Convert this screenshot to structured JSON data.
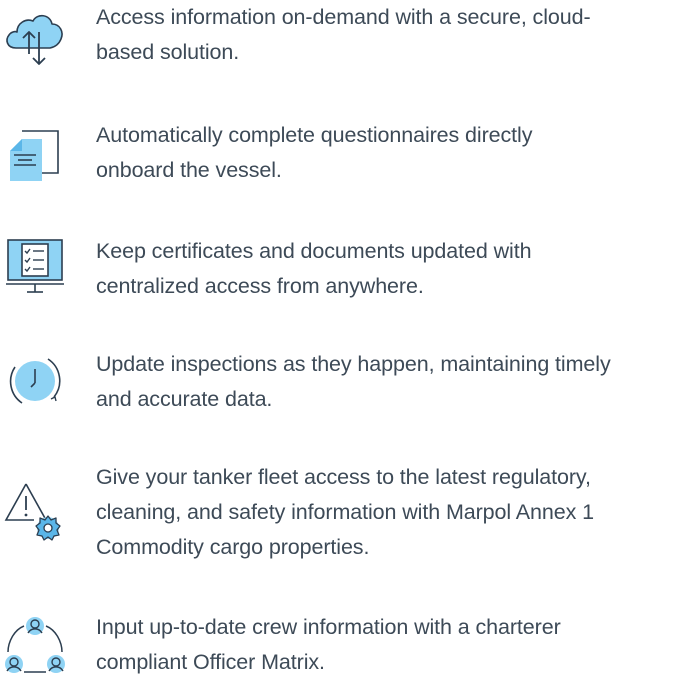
{
  "features": [
    {
      "icon": "cloud-sync-icon",
      "lines": [
        "Access information on-demand with a secure, cloud-",
        "based solution."
      ]
    },
    {
      "icon": "document-questionnaire-icon",
      "lines": [
        "Automatically complete questionnaires directly",
        "onboard the vessel."
      ]
    },
    {
      "icon": "monitor-checklist-icon",
      "lines": [
        "Keep certificates and documents updated with",
        "centralized access from anywhere."
      ]
    },
    {
      "icon": "clock-refresh-icon",
      "lines": [
        "Update inspections as they happen, maintaining timely",
        "and accurate data."
      ]
    },
    {
      "icon": "warning-gear-icon",
      "lines": [
        "Give your tanker fleet access to the latest regulatory,",
        "cleaning, and safety information with Marpol Annex 1",
        "Commodity cargo properties."
      ]
    },
    {
      "icon": "crew-network-icon",
      "lines": [
        "Input up-to-date crew information with a charterer",
        "compliant Officer Matrix."
      ]
    }
  ],
  "colors": {
    "icon_stroke": "#2c3e50",
    "icon_fill": "#8fd3f4",
    "icon_fill_dark": "#5bb6e8",
    "text": "#3d4a57"
  }
}
